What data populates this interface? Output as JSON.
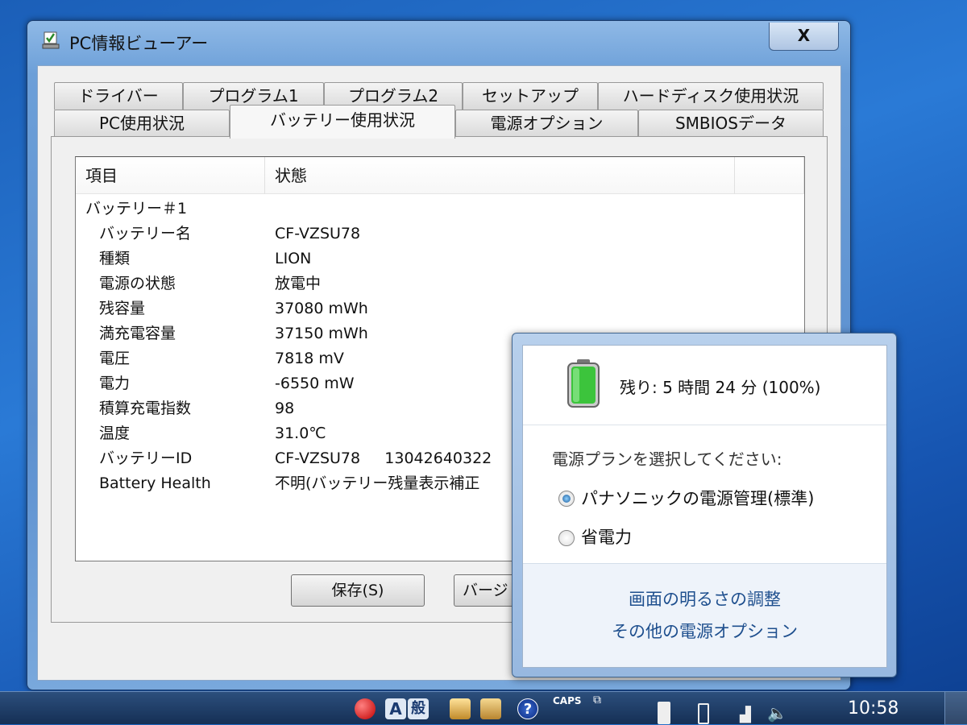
{
  "window": {
    "title": "PC情報ビューアー",
    "close_label": "X"
  },
  "tabs_row1": [
    "ドライバー",
    "プログラム1",
    "プログラム2",
    "セットアップ",
    "ハードディスク使用状況"
  ],
  "tabs_row2": [
    "PC使用状況",
    "バッテリー使用状況",
    "電源オプション",
    "SMBIOSデータ"
  ],
  "active_tab": "バッテリー使用状況",
  "list": {
    "headers": [
      "項目",
      "状態"
    ],
    "group": "バッテリー＃1",
    "rows": [
      {
        "item": "バッテリー名",
        "value": "CF-VZSU78"
      },
      {
        "item": "種類",
        "value": "LION"
      },
      {
        "item": "電源の状態",
        "value": "放電中"
      },
      {
        "item": "残容量",
        "value": "37080 mWh"
      },
      {
        "item": "満充電容量",
        "value": "37150 mWh"
      },
      {
        "item": "電圧",
        "value": "7818 mV"
      },
      {
        "item": "電力",
        "value": "-6550 mW"
      },
      {
        "item": "積算充電指数",
        "value": "98"
      },
      {
        "item": "温度",
        "value": "31.0℃"
      },
      {
        "item": "バッテリーID",
        "value": "CF-VZSU78     13042640322"
      },
      {
        "item": "Battery Health",
        "value": "不明(バッテリー残量表示補正"
      }
    ]
  },
  "buttons": {
    "save": "保存(S)",
    "version": "バージ"
  },
  "battery_popup": {
    "remaining": "残り: 5 時間 24 分 (100%)",
    "charge_percent": 100,
    "plan_prompt": "電源プランを選択してください:",
    "plans": [
      {
        "label": "パナソニックの電源管理(標準)",
        "selected": true
      },
      {
        "label": "省電力",
        "selected": false
      }
    ],
    "links": [
      "画面の明るさの調整",
      "その他の電源オプション"
    ]
  },
  "taskbar": {
    "caps": "CAPS",
    "ime_mode": "A",
    "ime_label": "般",
    "clock": "10:58"
  },
  "colors": {
    "link": "#1e4f8e",
    "battery_fill": "#3cc43c"
  }
}
